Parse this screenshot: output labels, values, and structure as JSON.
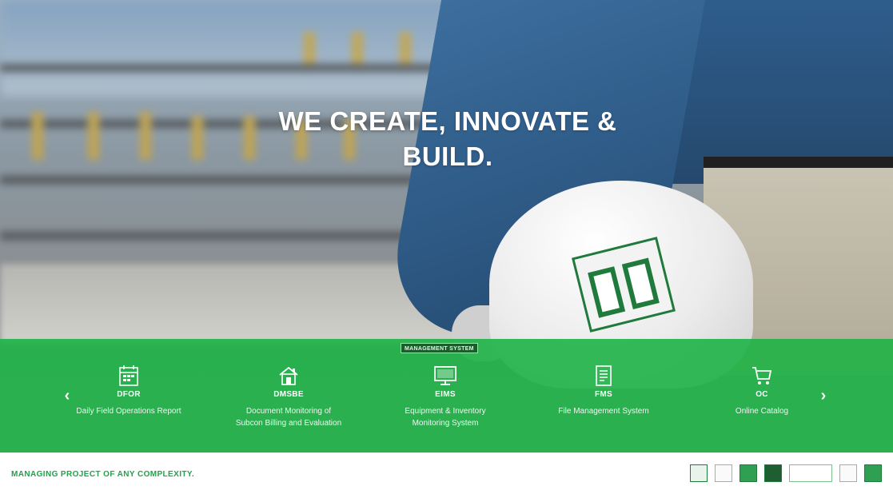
{
  "hero": {
    "headline_line1": "WE CREATE, INNOVATE &",
    "headline_line2": "BUILD."
  },
  "band": {
    "badge": "MANAGEMENT SYSTEM",
    "prev_icon": "chevron-left-icon",
    "next_icon": "chevron-right-icon",
    "systems": [
      {
        "icon": "calendar-icon",
        "code": "DFOR",
        "desc_line1": "Daily Field Operations Report",
        "desc_line2": ""
      },
      {
        "icon": "house-icon",
        "code": "DMSBE",
        "desc_line1": "Document Monitoring of",
        "desc_line2": "Subcon Billing and Evaluation"
      },
      {
        "icon": "monitor-icon",
        "code": "EIMS",
        "desc_line1": "Equipment & Inventory",
        "desc_line2": "Monitoring System"
      },
      {
        "icon": "document-icon",
        "code": "FMS",
        "desc_line1": "File Management System",
        "desc_line2": ""
      },
      {
        "icon": "cart-icon",
        "code": "OC",
        "desc_line1": "Online Catalog",
        "desc_line2": ""
      }
    ]
  },
  "footer": {
    "tagline": "MANAGING PROJECT OF ANY COMPLEXITY.",
    "logos": [
      "company-logo-1",
      "company-logo-2",
      "company-logo-3",
      "company-logo-4",
      "company-logo-5",
      "company-logo-6",
      "company-logo-7"
    ]
  },
  "colors": {
    "brand_green": "#1eb246",
    "dark_green": "#1f7a3c",
    "tagline_green": "#22a24a"
  }
}
